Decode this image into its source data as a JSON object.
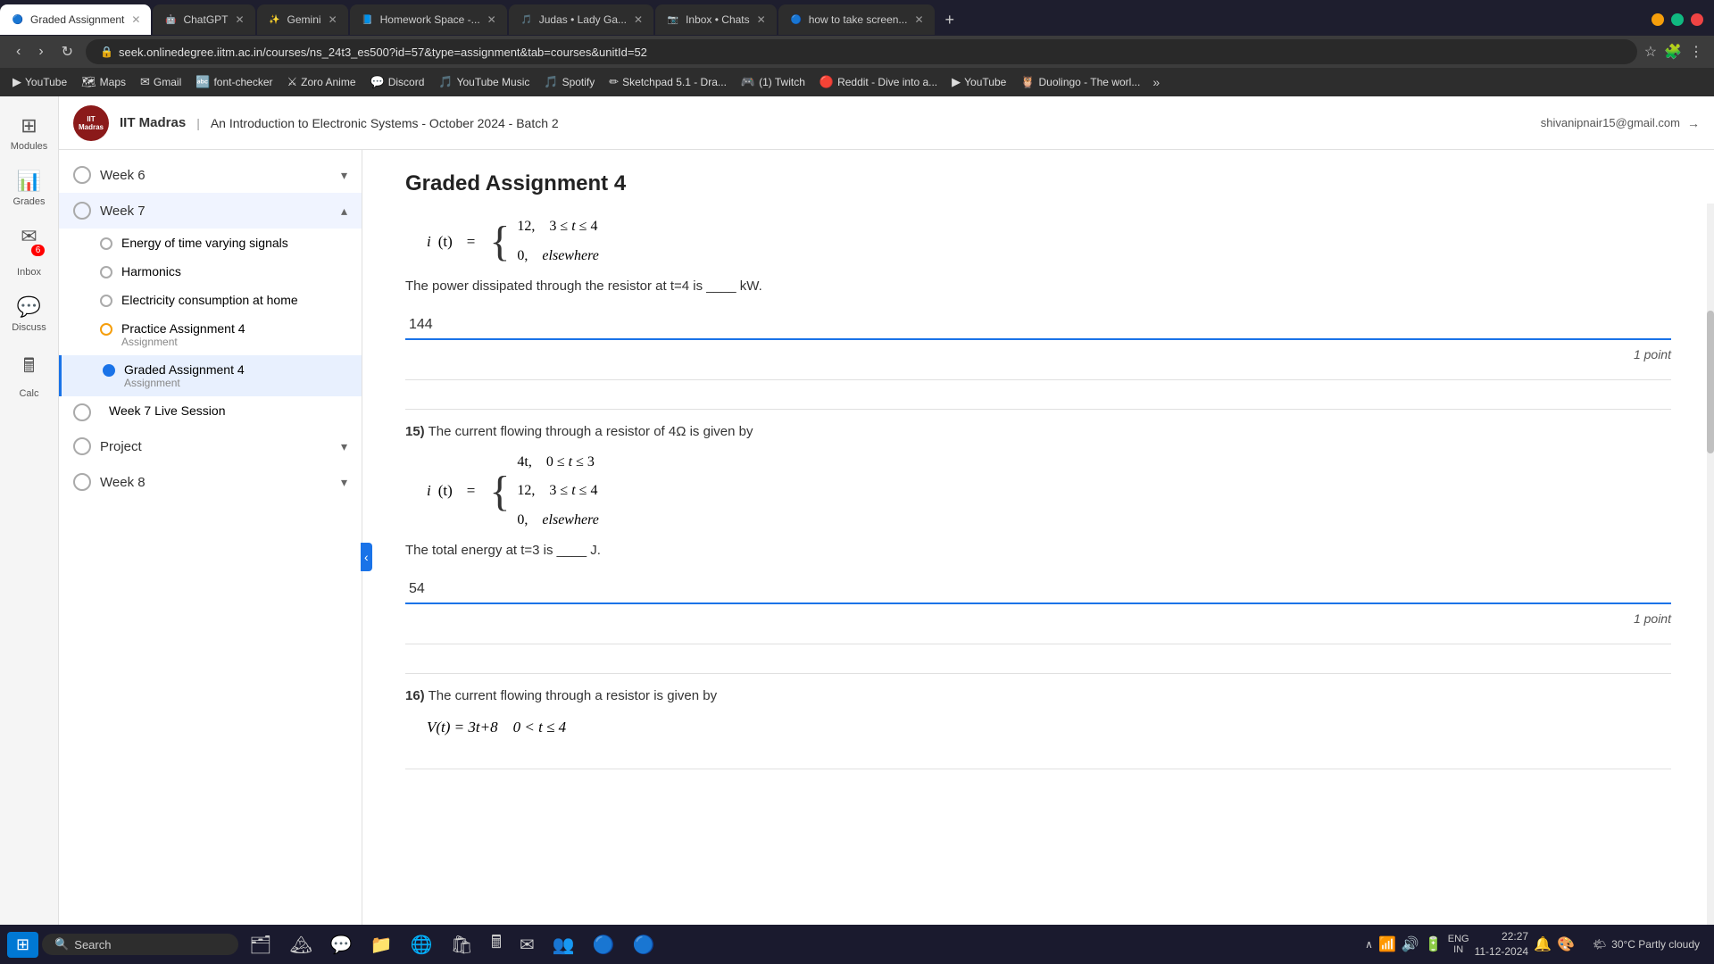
{
  "browser": {
    "tabs": [
      {
        "label": "Graded Assignment",
        "active": true,
        "icon": "🔵",
        "color": "#1a73e8"
      },
      {
        "label": "ChatGPT",
        "active": false,
        "icon": "🤖",
        "color": "#10a37f"
      },
      {
        "label": "Gemini",
        "active": false,
        "icon": "✨",
        "color": "#4285f4"
      },
      {
        "label": "Homework Space -...",
        "active": false,
        "icon": "📘",
        "color": "#5865f2"
      },
      {
        "label": "Judas • Lady Ga...",
        "active": false,
        "icon": "🎵",
        "color": "#1db954"
      },
      {
        "label": "Inbox • Chats",
        "active": false,
        "icon": "📷",
        "color": "#e4405f"
      },
      {
        "label": "how to take screen...",
        "active": false,
        "icon": "🔵",
        "color": "#1a73e8"
      }
    ],
    "url": "seek.onlinedegree.iitm.ac.in/courses/ns_24t3_es500?id=57&type=assignment&tab=courses&unitId=52",
    "bookmarks": [
      {
        "label": "YouTube",
        "icon": "▶"
      },
      {
        "label": "Maps",
        "icon": "🗺"
      },
      {
        "label": "Gmail",
        "icon": "✉"
      },
      {
        "label": "font-checker",
        "icon": "🔤"
      },
      {
        "label": "Zoro Anime",
        "icon": "⚔"
      },
      {
        "label": "Discord",
        "icon": "💬"
      },
      {
        "label": "YouTube Music",
        "icon": "🎵"
      },
      {
        "label": "Spotify",
        "icon": "🎵"
      },
      {
        "label": "Sketchpad 5.1 - Dra...",
        "icon": "✏"
      },
      {
        "label": "(1) Twitch",
        "icon": "🎮"
      },
      {
        "label": "Reddit - Dive into a...",
        "icon": "🔴"
      },
      {
        "label": "YouTube",
        "icon": "▶"
      },
      {
        "label": "Duolingo - The worl...",
        "icon": "🦉"
      }
    ]
  },
  "header": {
    "institution": "IIT Madras",
    "course": "An Introduction to Electronic Systems - October 2024 - Batch 2",
    "user_email": "shivanipnair15@gmail.com"
  },
  "left_nav": {
    "items": [
      {
        "label": "Modules",
        "icon": "⊞"
      },
      {
        "label": "Grades",
        "icon": "📊"
      },
      {
        "label": "Inbox",
        "icon": "✉",
        "badge": "6"
      },
      {
        "label": "Discuss",
        "icon": "💬"
      },
      {
        "label": "Calc",
        "icon": "🖩"
      }
    ]
  },
  "sidebar": {
    "weeks": [
      {
        "label": "Week 6",
        "expanded": false
      },
      {
        "label": "Week 7",
        "expanded": true,
        "items": [
          {
            "label": "Energy of time varying signals",
            "type": "lesson",
            "active": false
          },
          {
            "label": "Harmonics",
            "type": "lesson",
            "active": false
          },
          {
            "label": "Electricity consumption at home",
            "type": "lesson",
            "active": false
          },
          {
            "label": "Practice Assignment 4",
            "subtext": "Assignment",
            "type": "assignment",
            "active": false,
            "dot": "orange"
          },
          {
            "label": "Graded Assignment 4",
            "subtext": "Assignment",
            "type": "assignment",
            "active": true,
            "dot": "blue"
          }
        ]
      },
      {
        "label": "Week 7 Live Session",
        "type": "lesson",
        "active": false,
        "indent": false
      },
      {
        "label": "Project",
        "expanded": false
      },
      {
        "label": "Week 8",
        "expanded": false
      }
    ]
  },
  "assignment": {
    "title": "Graded Assignment 4",
    "questions": [
      {
        "number": "",
        "preamble": "i(t) = { 12,   3 ≤ t ≤ 4 | 0,   elsewhere",
        "question_text": "The power dissipated through the resistor at t=4 is ____ kW.",
        "answer": "144",
        "points": "1 point"
      },
      {
        "number": "15)",
        "preamble": "The current flowing through a resistor of 4Ω is given by",
        "piecewise": "i(t) = { 4t,   0 ≤ t ≤ 3 | 12,   3 ≤ t ≤ 4 | 0,   elsewhere",
        "question_text": "The total energy at t=3 is ____ J.",
        "answer": "54",
        "points": "1 point"
      },
      {
        "number": "16)",
        "preamble": "The current flowing through a resistor is given by",
        "piecewise_partial": "V(t) = 3t+8   0 < t ≤ 4",
        "question_text": "",
        "answer": "",
        "points": ""
      }
    ]
  },
  "taskbar": {
    "search_placeholder": "Search",
    "time": "22:27",
    "date": "11-12-2024",
    "language": "ENG\nIN",
    "weather": "30°C\nPartly cloudy"
  }
}
